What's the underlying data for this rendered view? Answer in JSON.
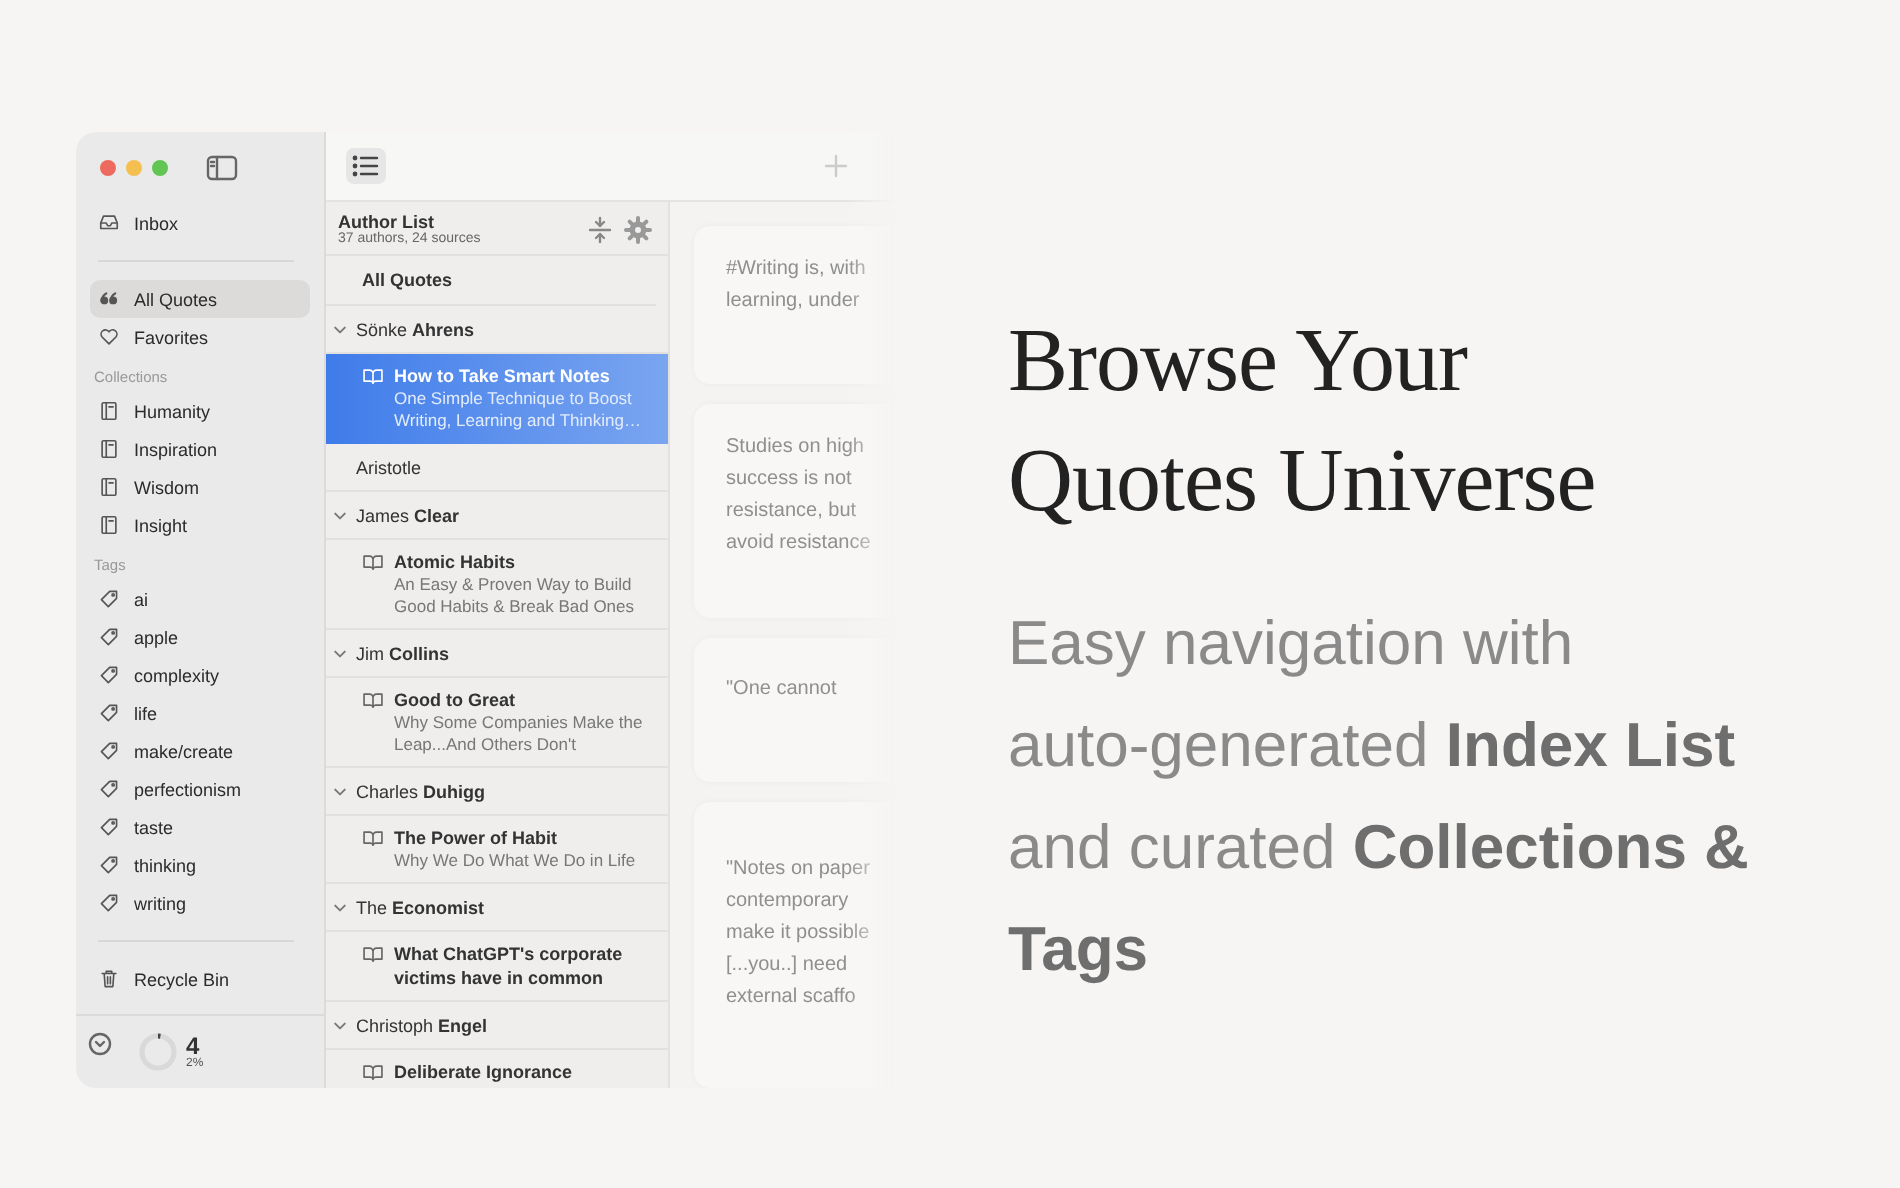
{
  "sidebar": {
    "items": [
      {
        "kind": "inbox",
        "label": "Inbox",
        "selected": false
      }
    ],
    "main_items": [
      {
        "kind": "quotes",
        "label": "All Quotes",
        "selected": true
      },
      {
        "kind": "heart",
        "label": "Favorites",
        "selected": false
      }
    ],
    "collections": {
      "header": "Collections",
      "items": [
        "Humanity",
        "Inspiration",
        "Wisdom",
        "Insight"
      ]
    },
    "tags": {
      "header": "Tags",
      "items": [
        "ai",
        "apple",
        "complexity",
        "life",
        "make/create",
        "perfectionism",
        "taste",
        "thinking",
        "writing"
      ]
    },
    "recycle_bin": "Recycle Bin",
    "footer": {
      "count": "4",
      "percent": "2%"
    }
  },
  "list": {
    "title": "Author List",
    "subtitle": "37 authors, 24 sources",
    "all_quotes": "All Quotes",
    "authors": [
      {
        "name": "Sönke **Ahrens**",
        "expanded": true,
        "books": [
          {
            "title": "How to Take Smart Notes",
            "subtitle": "One Simple Technique to Boost Writing, Learning and Thinking…",
            "selected": true
          }
        ]
      },
      {
        "name": "Aristotle"
      },
      {
        "name": "James **Clear**",
        "expanded": true,
        "books": [
          {
            "title": "Atomic Habits",
            "subtitle": "An Easy & Proven Way to Build Good Habits & Break Bad Ones",
            "selected": false
          }
        ]
      },
      {
        "name": "Jim **Collins**",
        "expanded": true,
        "books": [
          {
            "title": "Good to Great",
            "subtitle": "Why Some Companies Make the Leap...And Others Don't",
            "selected": false
          }
        ]
      },
      {
        "name": "Charles **Duhigg**",
        "expanded": true,
        "books": [
          {
            "title": "The Power of Habit",
            "subtitle": "Why We Do What We Do in Life",
            "selected": false
          }
        ]
      },
      {
        "name": "The **Economist**",
        "expanded": true,
        "books": [
          {
            "title": "What ChatGPT's corporate victims have in common",
            "selected": false
          }
        ]
      },
      {
        "name": "Christoph **Engel**",
        "expanded": true,
        "books": [
          {
            "title": "Deliberate Ignorance",
            "selected": false
          }
        ]
      }
    ]
  },
  "quotes": [
    {
      "lines": [
        "#Writing is, with",
        "learning, under"
      ]
    },
    {
      "lines": [
        "Studies on high",
        "success is not",
        "resistance, but",
        "avoid resistance"
      ]
    },
    {
      "lines": [
        "\"One cannot"
      ]
    },
    {
      "lines": [
        "\"Notes on paper",
        "contemporary",
        "make it possible",
        "[...you..] need",
        "external scaffo"
      ]
    }
  ],
  "headline": [
    "Browse Your",
    "Quotes Universe"
  ],
  "description": "Easy navigation with auto-generated **Index List** and curated **Collections & Tags**"
}
